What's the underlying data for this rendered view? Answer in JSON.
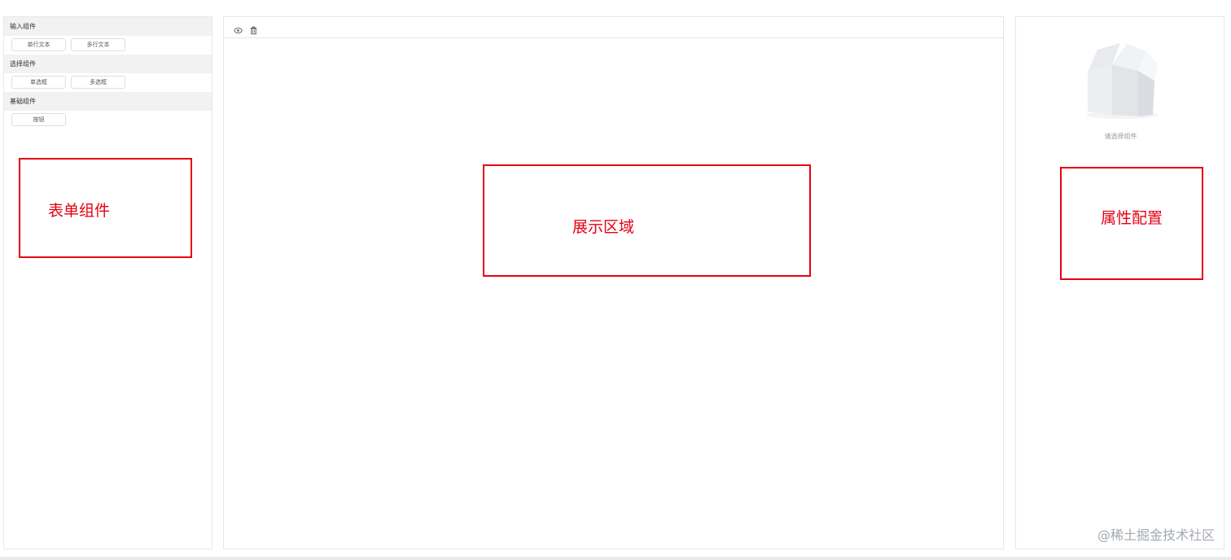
{
  "left": {
    "groups": [
      {
        "title": "输入组件",
        "buttons": [
          "单行文本",
          "多行文本"
        ]
      },
      {
        "title": "选择组件",
        "buttons": [
          "单选框",
          "多选框"
        ]
      },
      {
        "title": "基础组件",
        "buttons": [
          "按钮"
        ]
      }
    ],
    "annotation": "表单组件"
  },
  "center": {
    "icons": [
      "eye-icon",
      "trash-icon"
    ],
    "annotation": "展示区域"
  },
  "right": {
    "empty_text": "请选择组件",
    "annotation": "属性配置"
  },
  "watermark": "@稀土掘金技术社区",
  "colors": {
    "annotation": "#e60012",
    "border": "#e4e7ed",
    "group_bg": "#f2f2f2"
  }
}
